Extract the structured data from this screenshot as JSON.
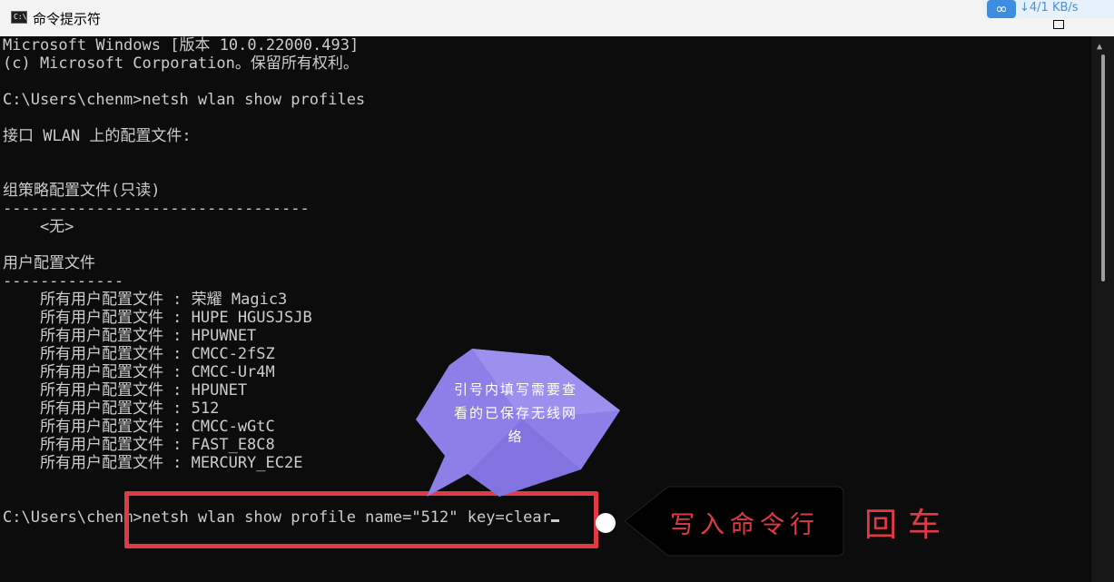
{
  "window": {
    "title": "命令提示符",
    "icon_label": "C:\\",
    "speed_badge": {
      "icon": "infinity-icon",
      "text": "↓4/1 KB/s"
    }
  },
  "console": {
    "lines": [
      "Microsoft Windows [版本 10.0.22000.493]",
      "(c) Microsoft Corporation。保留所有权利。",
      "",
      "C:\\Users\\chenm>netsh wlan show profiles",
      "",
      "接口 WLAN 上的配置文件:",
      "",
      "",
      "组策略配置文件(只读)",
      "---------------------------------",
      "    <无>",
      "",
      "用户配置文件",
      "-------------",
      "    所有用户配置文件 : 荣耀 Magic3",
      "    所有用户配置文件 : HUPE HGUSJSJB",
      "    所有用户配置文件 : HPUWNET",
      "    所有用户配置文件 : CMCC-2fSZ",
      "    所有用户配置文件 : CMCC-Ur4M",
      "    所有用户配置文件 : HPUNET",
      "    所有用户配置文件 : 512",
      "    所有用户配置文件 : CMCC-wGtC",
      "    所有用户配置文件 : FAST_E8C8",
      "    所有用户配置文件 : MERCURY_EC2E",
      "",
      "",
      "C:\\Users\\chenm>netsh wlan show profile name=\"512\" key=clear"
    ]
  },
  "annotations": {
    "callout_text": "引号内填写需要查看的已保存无线网络",
    "arrow_label": "写入命令行",
    "enter_label": "回车",
    "accent_color": "#e23a45",
    "callout_color": "#8c7fe8"
  }
}
